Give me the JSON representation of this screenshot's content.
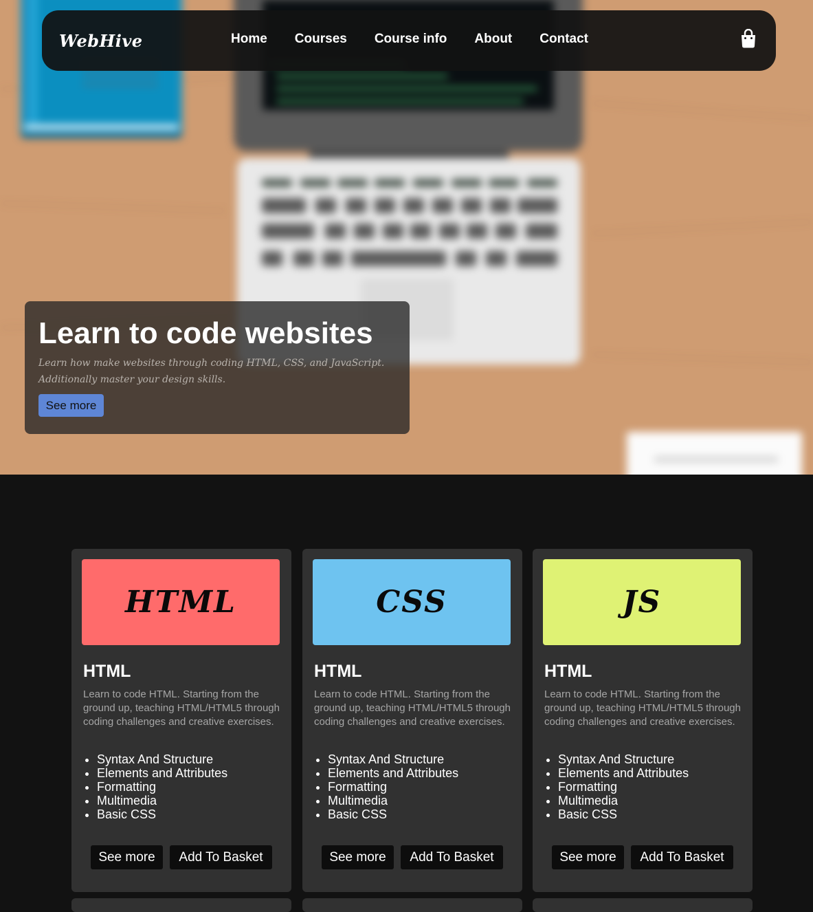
{
  "nav": {
    "logo": "WebHive",
    "links": [
      "Home",
      "Courses",
      "Course info",
      "About",
      "Contact"
    ],
    "basket_icon": "shopping-bag-icon"
  },
  "hero": {
    "title": "Learn to code websites",
    "subtitle_line1": "Learn how make websites through coding HTML, CSS, and JavaScript.",
    "subtitle_line2": "Additionally master your design skills.",
    "button": "See more",
    "button_color": "#5e86d6"
  },
  "courses": [
    {
      "banner": "HTML",
      "banner_color": "#ff6b6b",
      "title": "HTML",
      "description": "Learn to code HTML. Starting from the ground up, teaching HTML/HTML5 through coding challenges and creative exercises.",
      "topics": [
        "Syntax And Structure",
        "Elements and Attributes",
        "Formatting",
        "Multimedia",
        "Basic CSS"
      ],
      "see_more": "See more",
      "add_basket": "Add To Basket"
    },
    {
      "banner": "CSS",
      "banner_color": "#6ec3f0",
      "title": "HTML",
      "description": "Learn to code HTML. Starting from the ground up, teaching HTML/HTML5 through coding challenges and creative exercises.",
      "topics": [
        "Syntax And Structure",
        "Elements and Attributes",
        "Formatting",
        "Multimedia",
        "Basic CSS"
      ],
      "see_more": "See more",
      "add_basket": "Add To Basket"
    },
    {
      "banner": "JS",
      "banner_color": "#dff274",
      "title": "HTML",
      "description": "Learn to code HTML. Starting from the ground up, teaching HTML/HTML5 through coding challenges and creative exercises.",
      "topics": [
        "Syntax And Structure",
        "Elements and Attributes",
        "Formatting",
        "Multimedia",
        "Basic CSS"
      ],
      "see_more": "See more",
      "add_basket": "Add To Basket"
    }
  ]
}
